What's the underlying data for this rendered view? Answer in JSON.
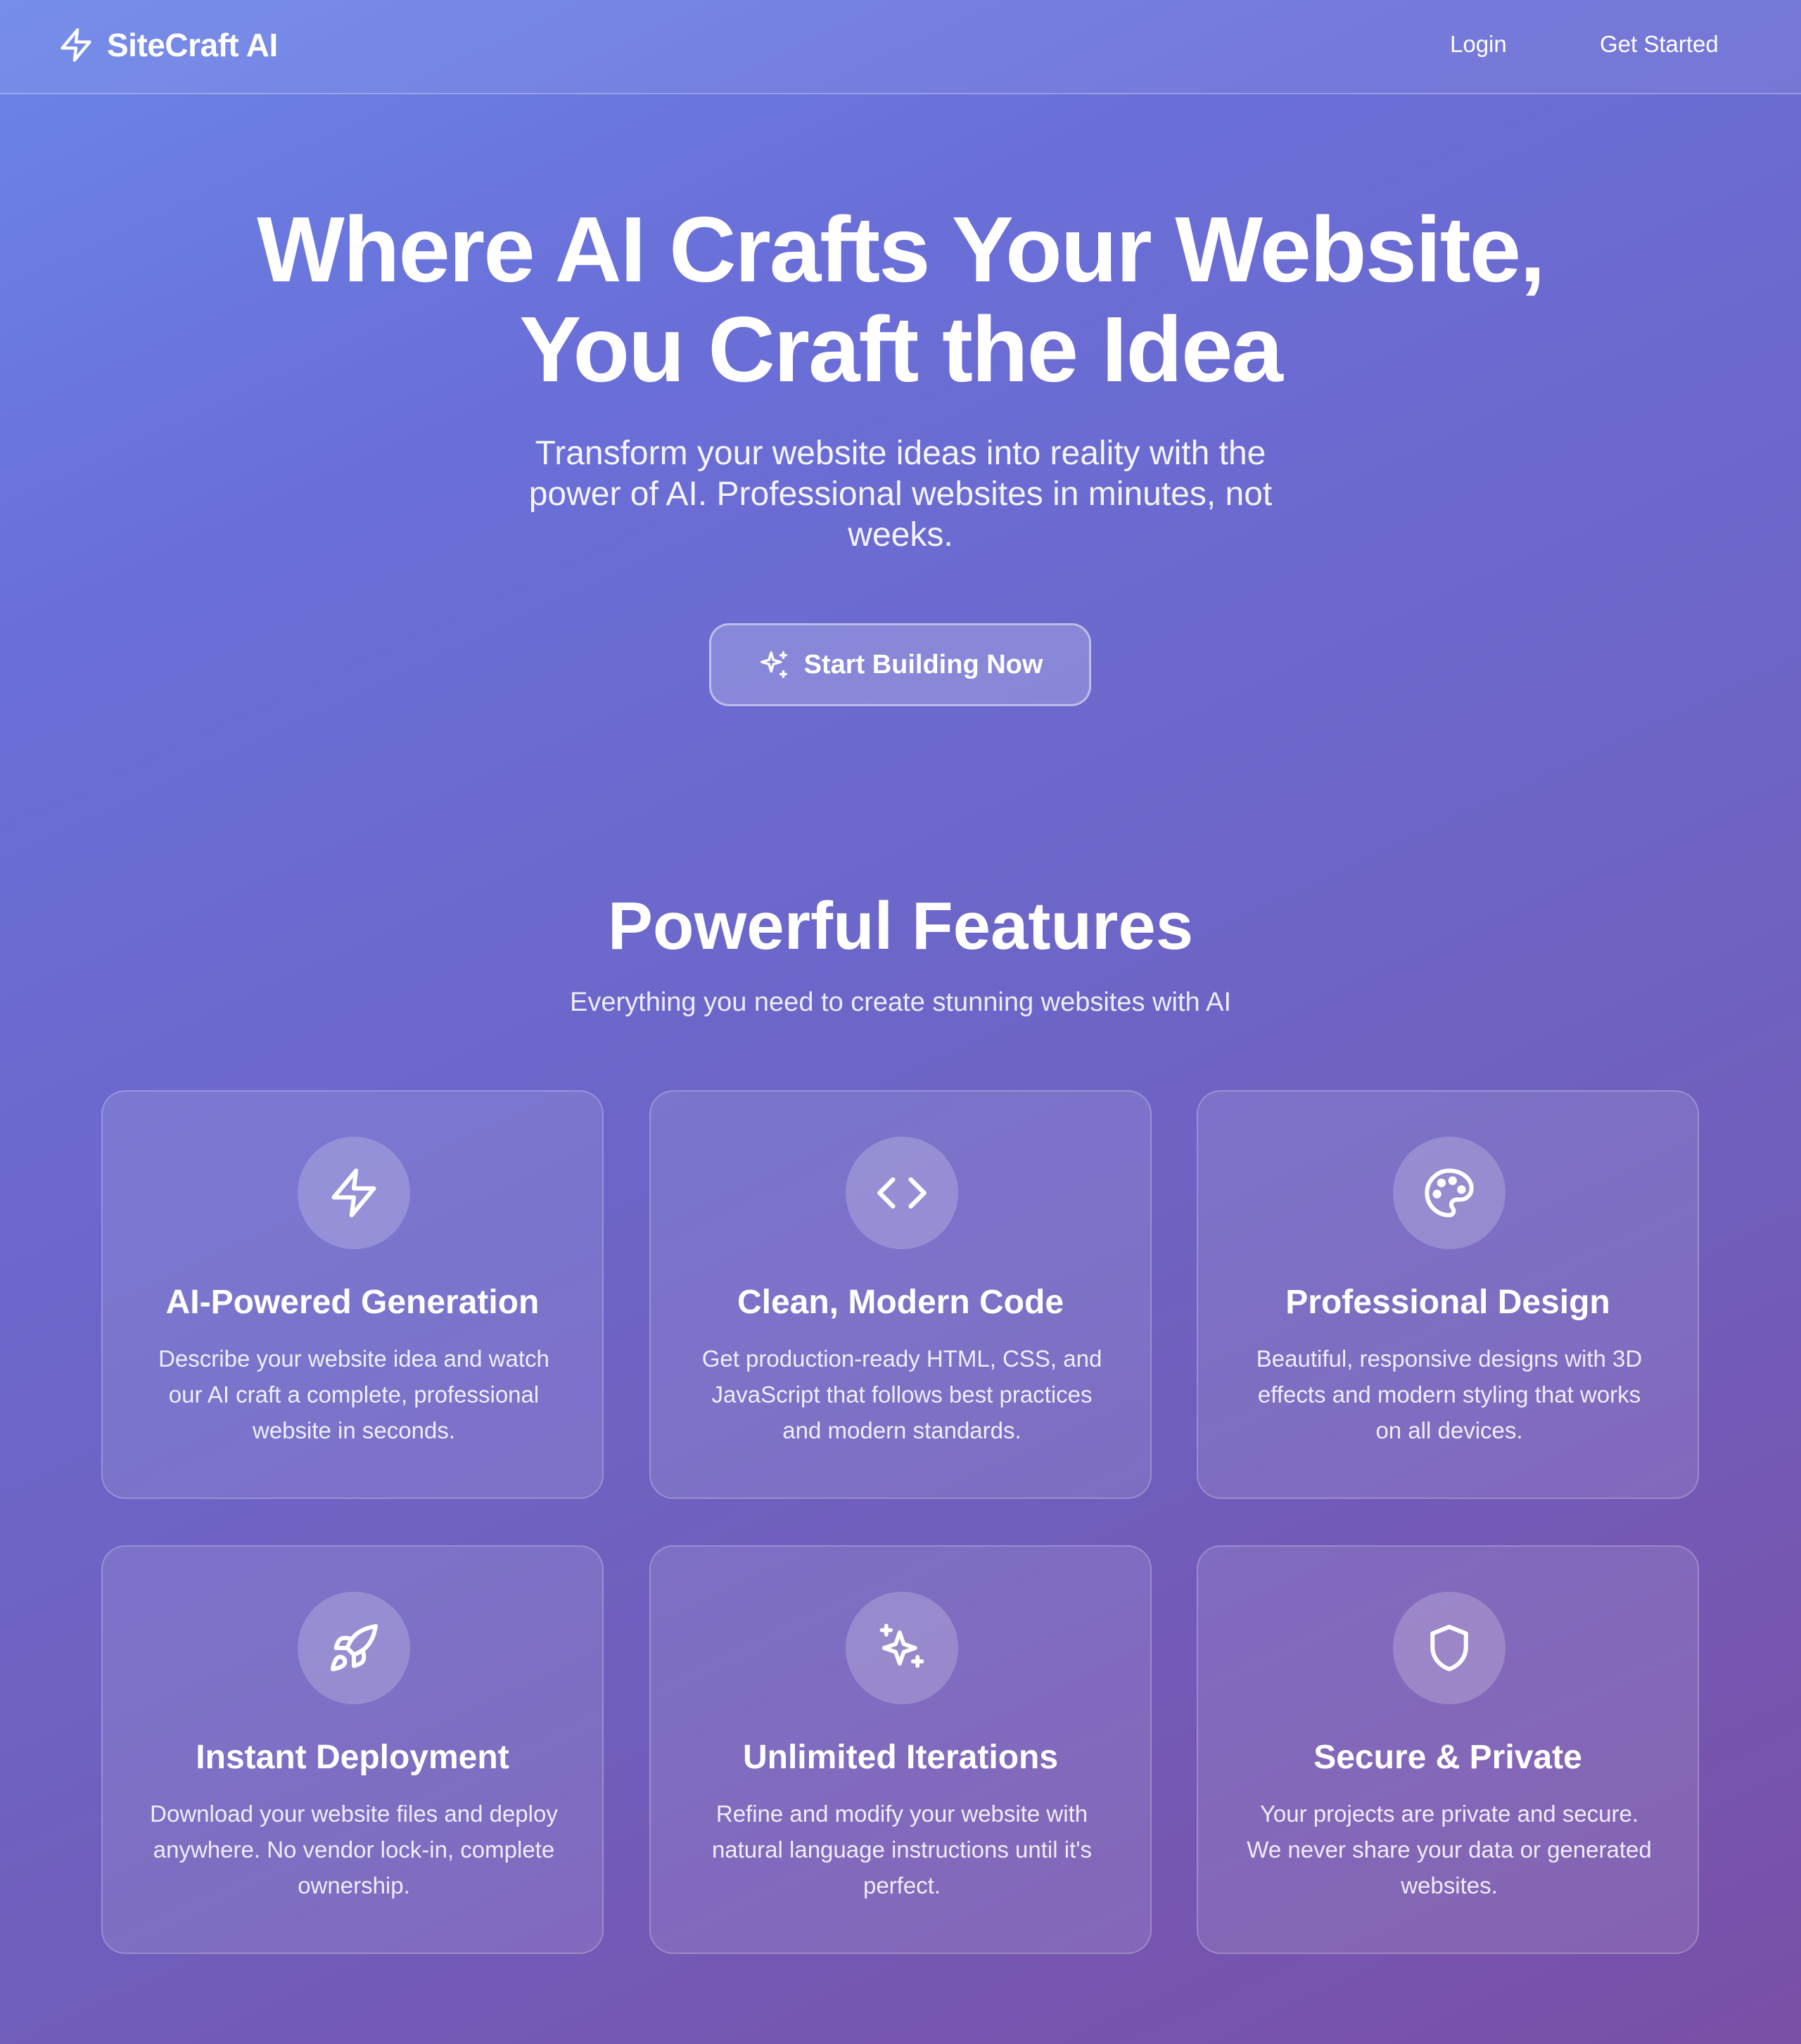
{
  "header": {
    "brand_name": "SiteCraft AI",
    "brand_icon": "lightning-bolt-icon",
    "nav": {
      "login": "Login",
      "get_started": "Get Started"
    }
  },
  "hero": {
    "title_line1": "Where AI Crafts Your Website,",
    "title_line2": "You Craft the Idea",
    "subtitle": "Transform your website ideas into reality with the power of AI. Professional websites in minutes, not weeks.",
    "cta_label": "Start Building Now",
    "cta_icon": "sparkles-icon"
  },
  "features": {
    "title": "Powerful Features",
    "subtitle": "Everything you need to create stunning websites with AI",
    "items": [
      {
        "icon": "lightning-bolt-icon",
        "title": "AI-Powered Generation",
        "description": "Describe your website idea and watch our AI craft a complete, professional website in seconds."
      },
      {
        "icon": "code-icon",
        "title": "Clean, Modern Code",
        "description": "Get production-ready HTML, CSS, and JavaScript that follows best practices and modern standards."
      },
      {
        "icon": "palette-icon",
        "title": "Professional Design",
        "description": "Beautiful, responsive designs with 3D effects and modern styling that works on all devices."
      },
      {
        "icon": "rocket-icon",
        "title": "Instant Deployment",
        "description": "Download your website files and deploy anywhere. No vendor lock-in, complete ownership."
      },
      {
        "icon": "sparkles-icon",
        "title": "Unlimited Iterations",
        "description": "Refine and modify your website with natural language instructions until it's perfect."
      },
      {
        "icon": "shield-icon",
        "title": "Secure & Private",
        "description": "Your projects are private and secure. We never share your data or generated websites."
      }
    ]
  },
  "colors": {
    "gradient_start": "#6b85e8",
    "gradient_mid": "#6e62c2",
    "gradient_end": "#7a4fa6",
    "text": "#ffffff"
  }
}
